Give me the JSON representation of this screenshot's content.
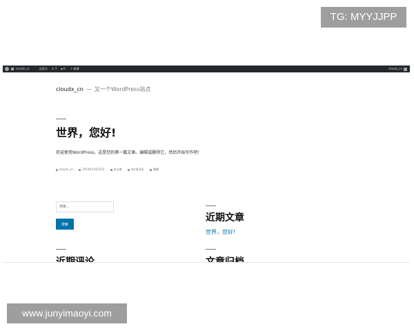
{
  "watermark_top": "TG: MYYJJPP",
  "watermark_bottom": "www.junyimaoyi.com",
  "admin_bar": {
    "site_name": "cloudx_cn",
    "customize": "自定义",
    "updates_count": "3",
    "comments_count": "0",
    "new_label": "新建",
    "user": "cloudx_cn"
  },
  "site": {
    "title": "cloudx_cn",
    "separator": "—",
    "description": "又一个WordPress站点"
  },
  "post": {
    "title": "世界，您好!",
    "body": "欢迎使用WordPress。这是您的第一篇文章。编辑或删除它，然后开始写作吧!",
    "meta": {
      "author": "cloudx_cn",
      "date": "2019年10月25日",
      "category": "未分类",
      "comments": "有1条评论",
      "edit": "编辑"
    }
  },
  "search": {
    "placeholder": "搜索...",
    "button_label": "搜索"
  },
  "widgets": {
    "recent_posts_title": "近期文章",
    "recent_posts_link": "世界，您好!",
    "recent_comments_title": "近期评论",
    "archives_title": "文章归档"
  }
}
